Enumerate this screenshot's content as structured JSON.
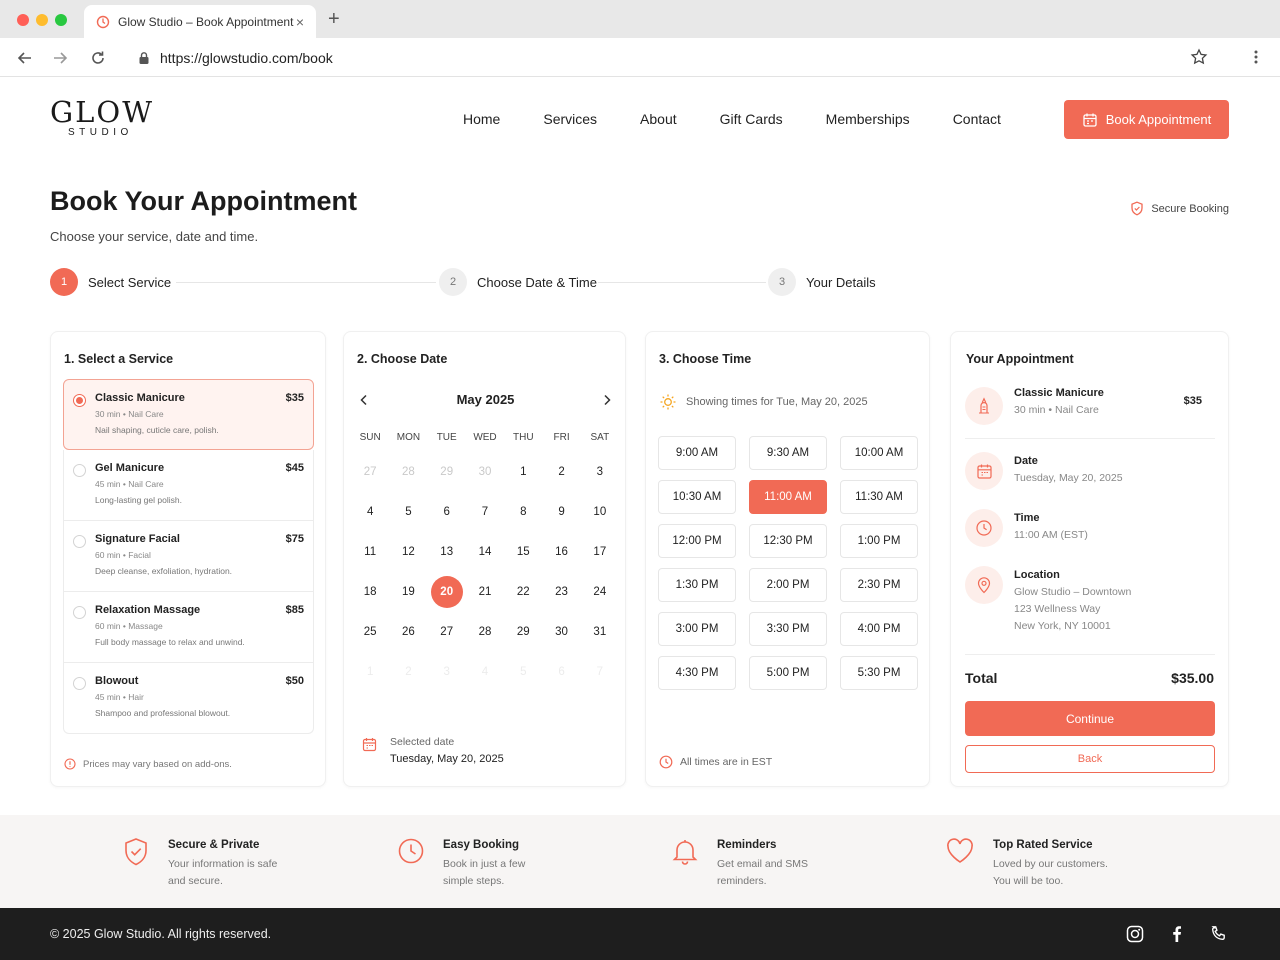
{
  "browser": {
    "tab_title": "Glow Studio – Book Appointment",
    "tab_close": "×",
    "new_tab": "+",
    "url": "https://glowstudio.com/book"
  },
  "site": {
    "logo_main": "GLOW",
    "logo_sub": "STUDIO",
    "nav": [
      "Home",
      "Services",
      "About",
      "Gift Cards",
      "Memberships",
      "Contact"
    ],
    "cta": "Book Appointment"
  },
  "page": {
    "title": "Book Your Appointment",
    "subtitle": "Choose your service, date and time.",
    "secure": "Secure Booking"
  },
  "steps": [
    {
      "num": "1",
      "label": "Select Service"
    },
    {
      "num": "2",
      "label": "Choose Date & Time"
    },
    {
      "num": "3",
      "label": "Your Details"
    }
  ],
  "services": {
    "title": "1. Select a Service",
    "items": [
      {
        "name": "Classic Manicure",
        "price": "$35",
        "duration": "30 min",
        "category": "Nail Care",
        "desc": "Nail shaping, cuticle care, polish.",
        "selected": true
      },
      {
        "name": "Gel Manicure",
        "price": "$45",
        "duration": "45 min",
        "category": "Nail Care",
        "desc": "Long-lasting gel polish."
      },
      {
        "name": "Signature Facial",
        "price": "$75",
        "duration": "60 min",
        "category": "Facial",
        "desc": "Deep cleanse, exfoliation, hydration."
      },
      {
        "name": "Relaxation Massage",
        "price": "$85",
        "duration": "60 min",
        "category": "Massage",
        "desc": "Full body massage to relax and unwind."
      },
      {
        "name": "Blowout",
        "price": "$50",
        "duration": "45 min",
        "category": "Hair",
        "desc": "Shampoo and professional blowout."
      }
    ],
    "note": "Prices may vary based on add-ons."
  },
  "calendar": {
    "title": "2. Choose Date",
    "month": "May 2025",
    "weekdays": [
      "SUN",
      "MON",
      "TUE",
      "WED",
      "THU",
      "FRI",
      "SAT"
    ],
    "weeks": [
      [
        "27",
        "28",
        "29",
        "30",
        "1",
        "2",
        "3"
      ],
      [
        "4",
        "5",
        "6",
        "7",
        "8",
        "9",
        "10"
      ],
      [
        "11",
        "12",
        "13",
        "14",
        "15",
        "16",
        "17"
      ],
      [
        "18",
        "19",
        "20",
        "21",
        "22",
        "23",
        "24"
      ],
      [
        "25",
        "26",
        "27",
        "28",
        "29",
        "30",
        "31"
      ],
      [
        "1",
        "2",
        "3",
        "4",
        "5",
        "6",
        "7"
      ]
    ],
    "selected_day": "20",
    "selected_label": "Selected date",
    "selected_value": "Tuesday, May 20, 2025"
  },
  "time": {
    "title": "3. Choose Time",
    "info": "Showing times for Tue, May 20, 2025",
    "slots": [
      "9:00 AM",
      "9:30 AM",
      "10:00 AM",
      "10:30 AM",
      "11:00 AM",
      "11:30 AM",
      "12:00 PM",
      "12:30 PM",
      "1:00 PM",
      "1:30 PM",
      "2:00 PM",
      "2:30 PM",
      "3:00 PM",
      "3:30 PM",
      "4:00 PM",
      "4:30 PM",
      "5:00 PM",
      "5:30 PM"
    ],
    "selected": "11:00 AM",
    "note": "All times are in EST"
  },
  "summary": {
    "title": "Your Appointment",
    "service_name": "Classic Manicure",
    "service_meta": "30 min  •  Nail Care",
    "service_price": "$35",
    "date_label": "Date",
    "date_value": "Tuesday, May 20, 2025",
    "time_label": "Time",
    "time_value": "11:00 AM (EST)",
    "location_label": "Location",
    "location_line1": "Glow Studio – Downtown",
    "location_line2": "123 Wellness Way",
    "location_line3": "New York, NY 10001",
    "total_label": "Total",
    "total_value": "$35.00",
    "continue": "Continue",
    "back": "Back"
  },
  "features": [
    {
      "title": "Secure & Private",
      "line1": "Your information is safe",
      "line2": "and secure."
    },
    {
      "title": "Easy Booking",
      "line1": "Book in just a few",
      "line2": "simple steps."
    },
    {
      "title": "Reminders",
      "line1": "Get email and SMS",
      "line2": "reminders."
    },
    {
      "title": "Top Rated Service",
      "line1": "Loved by our customers.",
      "line2": "You will be too."
    }
  ],
  "footer": {
    "copyright": "© 2025 Glow Studio. All rights reserved."
  },
  "colors": {
    "accent": "#f16a55",
    "accent_light": "#fdeeea",
    "footer_bg": "#1e1e1e"
  }
}
